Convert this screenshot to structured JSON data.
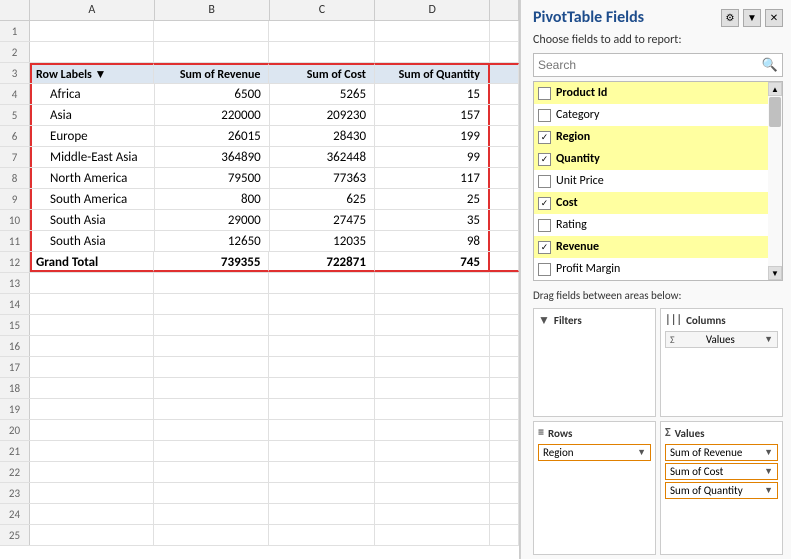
{
  "spreadsheet": {
    "col_headers": [
      "A",
      "B",
      "C",
      "D",
      ""
    ],
    "rows": [
      {
        "num": 1,
        "cells": [
          "",
          "",
          "",
          "",
          ""
        ]
      },
      {
        "num": 2,
        "cells": [
          "",
          "",
          "",
          "",
          ""
        ]
      },
      {
        "num": 3,
        "cells": [
          "Row Labels",
          "Sum of Revenue",
          "Sum of Cost",
          "Sum of Quantity",
          ""
        ],
        "type": "header"
      },
      {
        "num": 4,
        "cells": [
          "Africa",
          "6500",
          "5265",
          "15",
          ""
        ],
        "type": "data"
      },
      {
        "num": 5,
        "cells": [
          "Asia",
          "220000",
          "209230",
          "157",
          ""
        ],
        "type": "data"
      },
      {
        "num": 6,
        "cells": [
          "Europe",
          "26015",
          "28430",
          "199",
          ""
        ],
        "type": "data"
      },
      {
        "num": 7,
        "cells": [
          "Middle-East Asia",
          "364890",
          "362448",
          "99",
          ""
        ],
        "type": "data"
      },
      {
        "num": 8,
        "cells": [
          "North America",
          "79500",
          "77363",
          "117",
          ""
        ],
        "type": "data"
      },
      {
        "num": 9,
        "cells": [
          "South America",
          "800",
          "625",
          "25",
          ""
        ],
        "type": "data"
      },
      {
        "num": 10,
        "cells": [
          "South Asia",
          "29000",
          "27475",
          "35",
          ""
        ],
        "type": "data"
      },
      {
        "num": 11,
        "cells": [
          "South Asia",
          "12650",
          "12035",
          "98",
          ""
        ],
        "type": "data"
      },
      {
        "num": 12,
        "cells": [
          "Grand Total",
          "739355",
          "722871",
          "745",
          ""
        ],
        "type": "grand_total"
      },
      {
        "num": 13,
        "cells": [
          "",
          "",
          "",
          "",
          ""
        ],
        "type": "empty"
      },
      {
        "num": 14,
        "cells": [
          "",
          "",
          "",
          "",
          ""
        ],
        "type": "empty"
      },
      {
        "num": 15,
        "cells": [
          "",
          "",
          "",
          "",
          ""
        ],
        "type": "empty"
      },
      {
        "num": 16,
        "cells": [
          "",
          "",
          "",
          "",
          ""
        ],
        "type": "empty"
      },
      {
        "num": 17,
        "cells": [
          "",
          "",
          "",
          "",
          ""
        ],
        "type": "empty"
      },
      {
        "num": 18,
        "cells": [
          "",
          "",
          "",
          "",
          ""
        ],
        "type": "empty"
      },
      {
        "num": 19,
        "cells": [
          "",
          "",
          "",
          "",
          ""
        ],
        "type": "empty"
      },
      {
        "num": 20,
        "cells": [
          "",
          "",
          "",
          "",
          ""
        ],
        "type": "empty"
      },
      {
        "num": 21,
        "cells": [
          "",
          "",
          "",
          "",
          ""
        ],
        "type": "empty"
      },
      {
        "num": 22,
        "cells": [
          "",
          "",
          "",
          "",
          ""
        ],
        "type": "empty"
      },
      {
        "num": 23,
        "cells": [
          "",
          "",
          "",
          "",
          ""
        ],
        "type": "empty"
      },
      {
        "num": 24,
        "cells": [
          "",
          "",
          "",
          "",
          ""
        ],
        "type": "empty"
      },
      {
        "num": 25,
        "cells": [
          "",
          "",
          "",
          "",
          ""
        ],
        "type": "empty"
      }
    ]
  },
  "pivot_panel": {
    "title": "PivotTable Fields",
    "choose_label": "Choose fields to add to report:",
    "search_placeholder": "Search",
    "fields": [
      {
        "name": "Product Id",
        "checked": false,
        "highlighted": true
      },
      {
        "name": "Category",
        "checked": false,
        "highlighted": false
      },
      {
        "name": "Region",
        "checked": true,
        "highlighted": true
      },
      {
        "name": "Quantity",
        "checked": true,
        "highlighted": true
      },
      {
        "name": "Unit Price",
        "checked": false,
        "highlighted": false
      },
      {
        "name": "Cost",
        "checked": true,
        "highlighted": true
      },
      {
        "name": "Rating",
        "checked": false,
        "highlighted": false
      },
      {
        "name": "Revenue",
        "checked": true,
        "highlighted": true
      },
      {
        "name": "Profit Margin",
        "checked": false,
        "highlighted": false
      }
    ],
    "drag_label": "Drag fields between areas below:",
    "areas": {
      "filters": {
        "label": "Filters",
        "icon": "▼",
        "items": []
      },
      "columns": {
        "label": "Columns",
        "icon": "|||",
        "items": [
          {
            "label": "Σ Values",
            "arrow": "▼"
          }
        ]
      },
      "rows": {
        "label": "Rows",
        "icon": "≡",
        "items": [
          {
            "label": "Region",
            "arrow": "▼"
          }
        ]
      },
      "values": {
        "label": "Values",
        "icon": "Σ",
        "items": [
          {
            "label": "Sum of Revenue",
            "arrow": "▼"
          },
          {
            "label": "Sum of Cost",
            "arrow": "▼"
          },
          {
            "label": "Sum of Quantity",
            "arrow": "▼"
          }
        ]
      }
    }
  }
}
